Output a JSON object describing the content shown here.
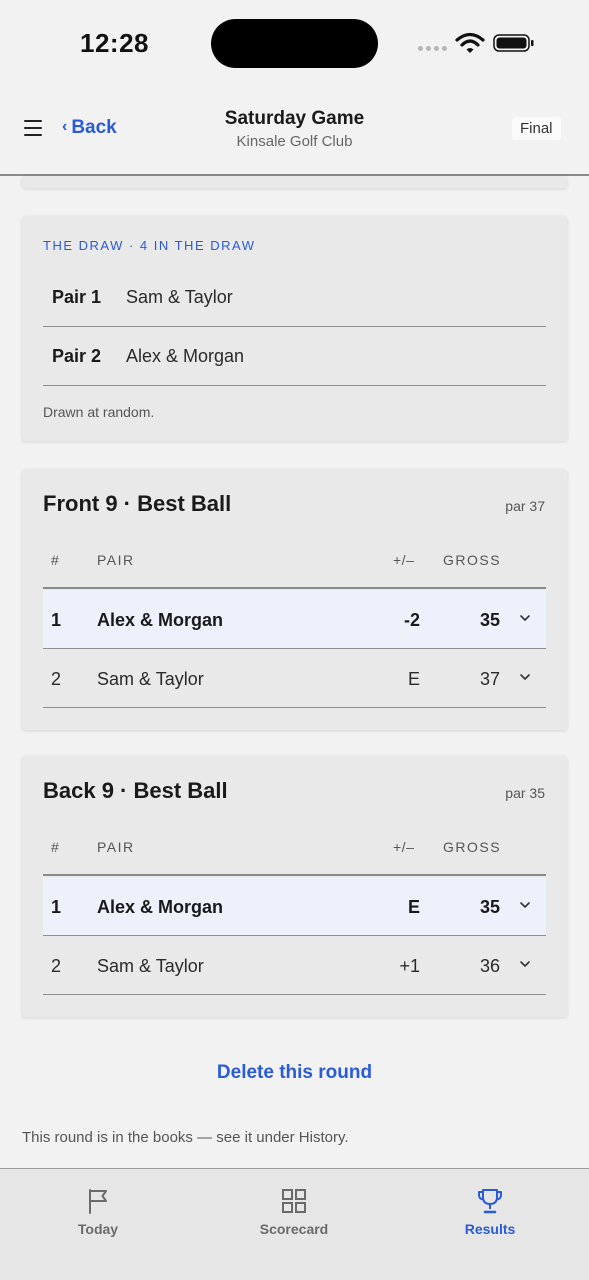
{
  "status_bar": {
    "time": "12:28"
  },
  "header": {
    "back_label": "Back",
    "title": "Saturday Game",
    "subtitle": "Kinsale Golf Club",
    "status_badge": "Final"
  },
  "draw": {
    "heading": "THE DRAW · 4 IN THE DRAW",
    "pairs": [
      {
        "label": "Pair 1",
        "names": "Sam & Taylor"
      },
      {
        "label": "Pair 2",
        "names": "Alex & Morgan"
      }
    ],
    "note": "Drawn at random."
  },
  "columns": {
    "num": "#",
    "pair": "PAIR",
    "plus_minus": "+/–",
    "gross": "GROSS"
  },
  "games": [
    {
      "title": "Front 9 · Best Ball",
      "par": "par 37",
      "rows": [
        {
          "rank": "1",
          "pair": "Alex & Morgan",
          "to_par": "-2",
          "gross": "35"
        },
        {
          "rank": "2",
          "pair": "Sam & Taylor",
          "to_par": "E",
          "gross": "37"
        }
      ]
    },
    {
      "title": "Back 9 · Best Ball",
      "par": "par 35",
      "rows": [
        {
          "rank": "1",
          "pair": "Alex & Morgan",
          "to_par": "E",
          "gross": "35"
        },
        {
          "rank": "2",
          "pair": "Sam & Taylor",
          "to_par": "+1",
          "gross": "36"
        }
      ]
    }
  ],
  "actions": {
    "delete_label": "Delete this round"
  },
  "footnote": "This round is in the books — see it under History.",
  "tabs": [
    {
      "label": "Today",
      "icon": "flag-icon"
    },
    {
      "label": "Scorecard",
      "icon": "grid-icon"
    },
    {
      "label": "Results",
      "icon": "trophy-icon",
      "active": true
    }
  ],
  "colors": {
    "accent": "#2a5bd7",
    "highlight_row": "#edf1fb",
    "card": "#e9e9e9",
    "background": "#f2f2f2"
  }
}
